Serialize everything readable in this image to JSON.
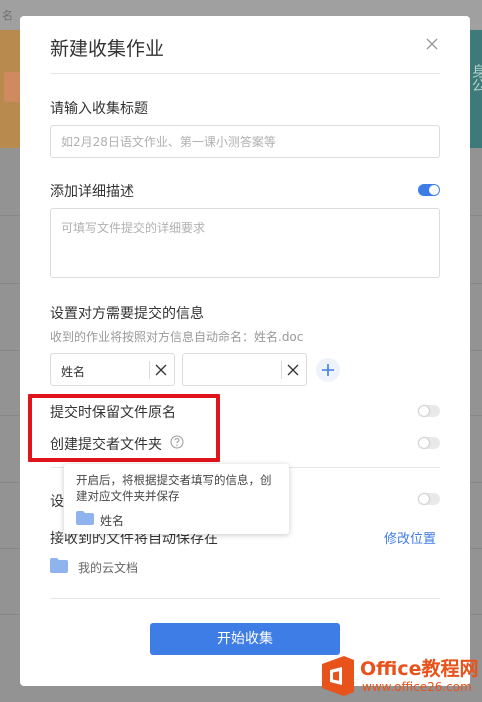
{
  "background": {
    "topbar_text": "名",
    "banner_right_text": "身公"
  },
  "modal": {
    "title": "新建收集作业",
    "title_input": {
      "label": "请输入收集标题",
      "placeholder": "如2月28日语文作业、第一课小测答案等"
    },
    "description": {
      "label": "添加详细描述",
      "enabled": true,
      "placeholder": "可填写文件提交的详细要求"
    },
    "submitter_info": {
      "label": "设置对方需要提交的信息",
      "hint": "收到的作业将按照对方信息自动命名：姓名.doc",
      "fields": [
        "姓名",
        ""
      ]
    },
    "options": [
      {
        "label": "提交时保留文件原名",
        "enabled": false
      },
      {
        "label": "创建提交者文件夹",
        "enabled": false,
        "has_help": true
      },
      {
        "label": "设",
        "enabled": false
      }
    ],
    "tooltip": {
      "text": "开启后，将根据提交者填写的信息，创建对应文件夹并保存",
      "folder_name": "姓名"
    },
    "save_location": {
      "label": "接收到的文件将自动保存在",
      "change_link": "修改位置",
      "folder_name": "我的云文档"
    },
    "start_button": "开始收集"
  },
  "watermark": {
    "name": "Office教程网",
    "url": "www.office26.com"
  },
  "colors": {
    "accent": "#3e7ce6",
    "highlight": "#e0141b",
    "watermark": "#e8531c"
  }
}
